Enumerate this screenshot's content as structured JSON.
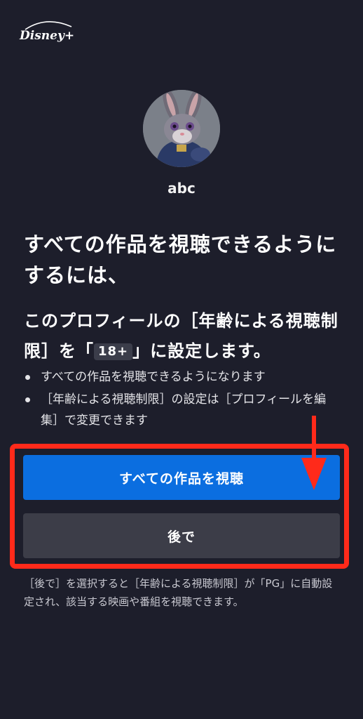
{
  "app": {
    "logo_text": "Disney+"
  },
  "profile": {
    "name": "abc",
    "avatar_icon": "rabbit-officer-avatar"
  },
  "heading": "すべての作品を視聴できるようにするには、",
  "subheading": {
    "before": "このプロフィールの［年齢による視聴制限］を「",
    "badge": "18+",
    "after": "」に設定します。"
  },
  "bullets": [
    "すべての作品を視聴できるようになります",
    "［年齢による視聴制限］の設定は［プロフィールを編集］で変更できます"
  ],
  "buttons": {
    "primary_label": "すべての作品を視聴",
    "secondary_label": "後で"
  },
  "note": "［後で］を選択すると［年齢による視聴制限］が「PG」に自動設定され、該当する映画や番組を視聴できます。",
  "colors": {
    "background": "#1d1e2b",
    "primary_button": "#0b6ee0",
    "secondary_button": "#3c3d48",
    "annotation_red": "#ff2a1a"
  }
}
